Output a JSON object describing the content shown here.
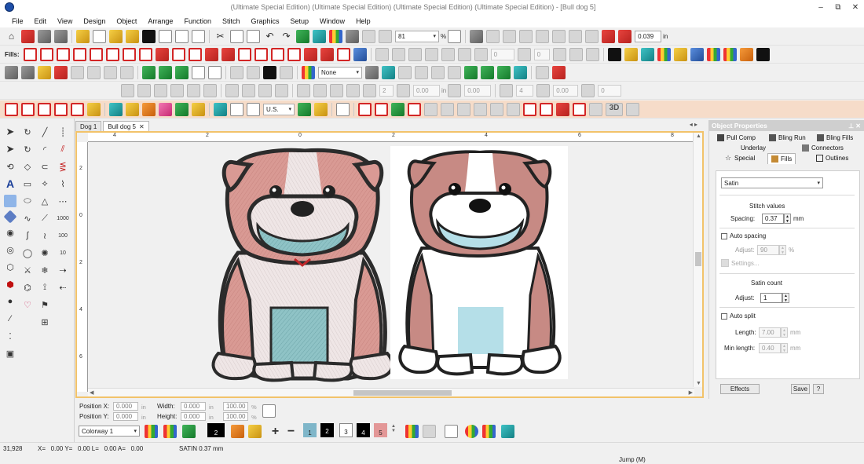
{
  "window": {
    "title": "(Ultimate Special Edition) (Ultimate Special Edition) (Ultimate Special Edition) (Ultimate Special Edition) - [Bull dog 5]",
    "controls": [
      "–",
      "⧉",
      "✕"
    ]
  },
  "menu": [
    "File",
    "Edit",
    "View",
    "Design",
    "Object",
    "Arrange",
    "Function",
    "Stitch",
    "Graphics",
    "Setup",
    "Window",
    "Help"
  ],
  "toolbar1": {
    "zoom_value": "81",
    "zoom_unit": "%",
    "size_value": "0.039",
    "size_unit": "in"
  },
  "toolbar2": {
    "fills_label": "Fills:",
    "angle_value": "0",
    "rotate_value": "0"
  },
  "toolbar3": {
    "none_value": "None",
    "count1": "2",
    "amount1": "0.00",
    "unit_in": "in",
    "amount2": "0.00",
    "count2": "4",
    "amount3": "0.00",
    "amount4": "0"
  },
  "toolbar4": {
    "region_value": "U.S.",
    "three_d_label": "3D"
  },
  "documents": {
    "tabs": [
      "Dog 1",
      "Bull dog 5"
    ],
    "active": "Bull dog 5",
    "nav": "◂ ▸"
  },
  "rulers": {
    "top": [
      "4",
      "2",
      "0",
      "2",
      "4",
      "6",
      "8"
    ],
    "left": [
      "2",
      "0",
      "2",
      "4",
      "6"
    ]
  },
  "object_properties": {
    "title": "Object Properties",
    "tabs": {
      "pull_comp": "Pull Comp",
      "bling_run": "Bling Run",
      "bling_fills": "Bling Fills",
      "underlay": "Underlay",
      "connectors": "Connectors",
      "special": "Special",
      "fills": "Fills",
      "outlines": "Outlines"
    },
    "fill_type": "Satin",
    "stitch_values_heading": "Stitch values",
    "spacing_label": "Spacing:",
    "spacing_value": "0.37",
    "spacing_unit": "mm",
    "auto_spacing_label": "Auto spacing",
    "adjust_label": "Adjust:",
    "adjust_value": "90",
    "adjust_unit": "%",
    "settings_label": "Settings...",
    "satin_count_heading": "Satin count",
    "satin_adjust_label": "Adjust:",
    "satin_adjust_value": "1",
    "auto_split_label": "Auto split",
    "length_label": "Length:",
    "length_value": "7.00",
    "length_unit": "mm",
    "min_length_label": "Min length:",
    "min_length_value": "0.40",
    "min_length_unit": "mm",
    "effects_button": "Effects",
    "save_button": "Save",
    "help_button": "?"
  },
  "position": {
    "pos_x_label": "Position X:",
    "pos_x": "0.000",
    "pos_y_label": "Position Y:",
    "pos_y": "0.000",
    "width_label": "Width:",
    "width": "0.000",
    "height_label": "Height:",
    "height": "0.000",
    "unit": "in",
    "scale_x": "100.00",
    "scale_y": "100.00",
    "pct": "%"
  },
  "colorway": {
    "value": "Colorway 1",
    "swatches": [
      {
        "label": "1",
        "color": "#7fb6c9"
      },
      {
        "label": "2",
        "color": "#000000"
      },
      {
        "label": "3",
        "color": "#ffffff"
      },
      {
        "label": "4",
        "color": "#000000"
      },
      {
        "label": "5",
        "color": "#e39797"
      }
    ],
    "thread_count": "2"
  },
  "status": {
    "stitches": "31,928",
    "coords": "X=   0.00 Y=   0.00 L=   0.00 A=   0.00",
    "stitch_info": "SATIN  0.37 mm",
    "mode": "Jump (M)"
  },
  "colors": {
    "accent_border": "#f2c36a",
    "dog_pink": "#d99a94",
    "dog_outline": "#2b2b2b",
    "dog_blue": "#a9dbe5"
  }
}
